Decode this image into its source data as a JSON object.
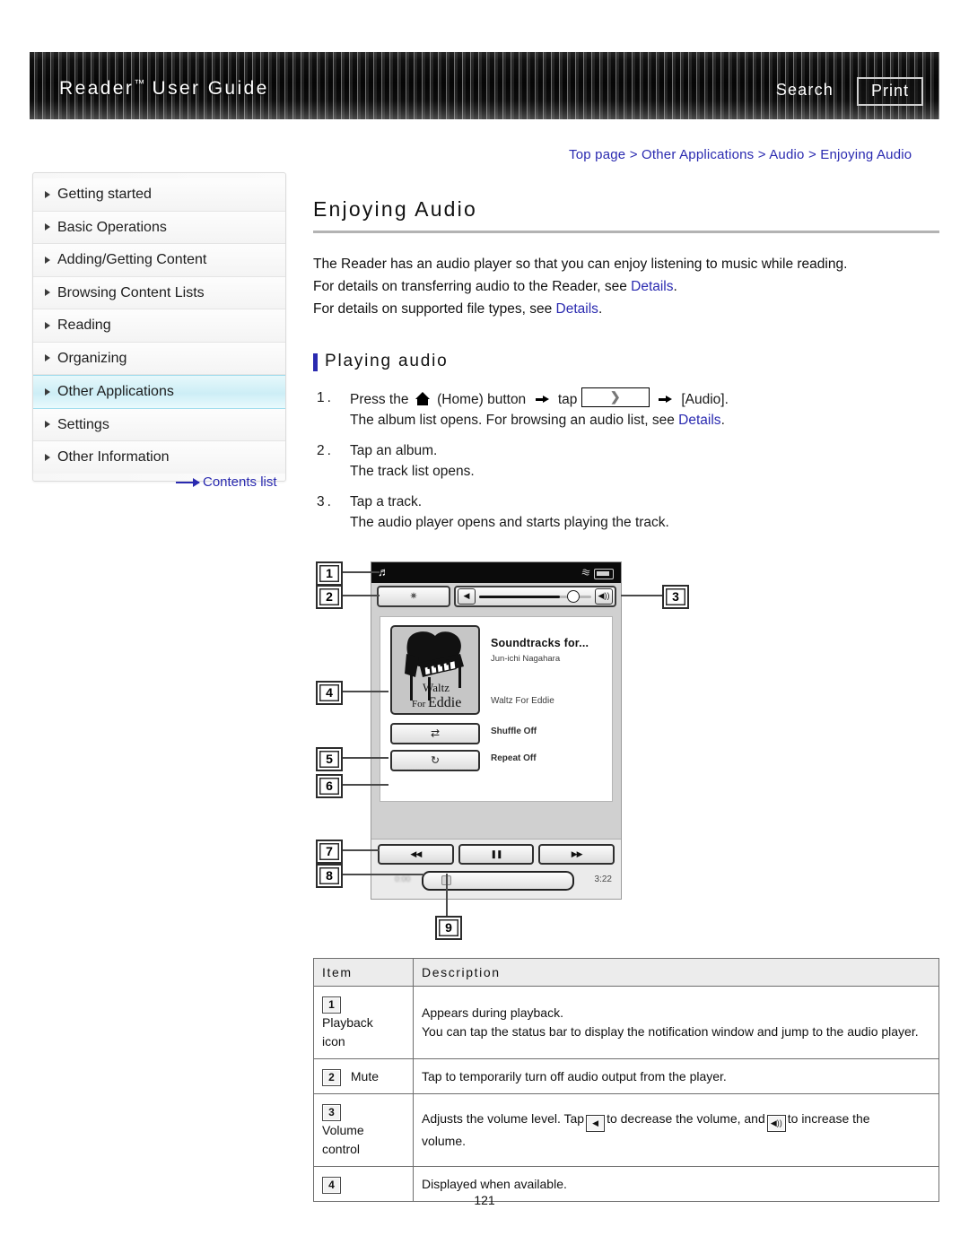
{
  "header": {
    "title": "Reader",
    "tm": "™",
    "title_rest": " User Guide",
    "search_label": "Search",
    "print_label": "Print"
  },
  "breadcrumb": {
    "text": "Top page > Other Applications > Audio > Enjoying Audio"
  },
  "sidebar": {
    "items": [
      {
        "label": "Getting started",
        "active": false
      },
      {
        "label": "Basic Operations",
        "active": false
      },
      {
        "label": "Adding/Getting Content",
        "active": false
      },
      {
        "label": "Browsing Content Lists",
        "active": false
      },
      {
        "label": "Reading",
        "active": false
      },
      {
        "label": "Organizing",
        "active": false
      },
      {
        "label": "Other Applications",
        "active": true
      },
      {
        "label": "Settings",
        "active": false
      },
      {
        "label": "Other Information",
        "active": false
      }
    ],
    "contents_link": "Contents list"
  },
  "main": {
    "page_title": "Enjoying Audio",
    "intro": [
      "The Reader has an audio player so that you can enjoy listening to music while reading.",
      "For details on transferring audio to the Reader, see ",
      "For details on supported file types, see "
    ],
    "details_label": "Details",
    "section_title": "Playing audio",
    "steps": [
      {
        "num": "1.",
        "lead_a": "Press the",
        "lead_b": "(Home) button",
        "lead_c": "tap",
        "lead_d": "[Audio].",
        "sub_a": "The album list opens. For browsing an audio list, see ",
        "sub_b": "Details",
        "sub_c": "."
      },
      {
        "num": "2.",
        "lead_a": "Tap an album.",
        "sub_a": "The track list opens."
      },
      {
        "num": "3.",
        "lead_a": "Tap a track.",
        "sub_a": "The audio player opens and starts playing the track."
      }
    ]
  },
  "device": {
    "status_note_icon": "♬",
    "status_wifi_icon": "≋",
    "mute_icon": "✷",
    "volume_down_icon": "◀",
    "volume_up_icon": "◀))",
    "album_art_line1": "Waltz",
    "album_art_line2_small": "For",
    "album_art_line2_big": "Eddie",
    "meta_title": "Soundtracks for...",
    "meta_artist": "Jun-ichi Nagahara",
    "meta_track": "Waltz For Eddie",
    "shuffle_icon": "⇄",
    "shuffle_label": "Shuffle Off",
    "repeat_icon": "↻",
    "repeat_label": "Repeat Off",
    "prev_icon": "◀◀",
    "pause_icon": "❚❚",
    "next_icon": "▶▶",
    "elapsed": "0:00",
    "total": "3:22",
    "callouts": [
      "1",
      "2",
      "3",
      "4",
      "5",
      "6",
      "7",
      "8",
      "9"
    ]
  },
  "table": {
    "headers": [
      "Item",
      "Description"
    ],
    "rows": [
      {
        "num": "1",
        "item_label_1": "Playback",
        "item_label_2": "icon",
        "desc_line1": "Appears during playback.",
        "desc_line2": "You can tap the status bar to display the notification window and jump to the audio",
        "desc_line3": "player."
      },
      {
        "num": "2",
        "item_label_inline": "Mute",
        "desc_line1": "Tap to temporarily turn off audio output from the player."
      },
      {
        "num": "3",
        "item_label_1": "Volume",
        "item_label_2": "control",
        "desc_a": "Adjusts the volume level. Tap",
        "desc_b": "to decrease the volume, and",
        "desc_c": "to increase the",
        "desc_d": "volume.",
        "icon_down": "◀",
        "icon_up": "◀))"
      },
      {
        "num": "4",
        "desc_line1": "Displayed when available."
      }
    ]
  },
  "footer": {
    "page_number": "121"
  }
}
